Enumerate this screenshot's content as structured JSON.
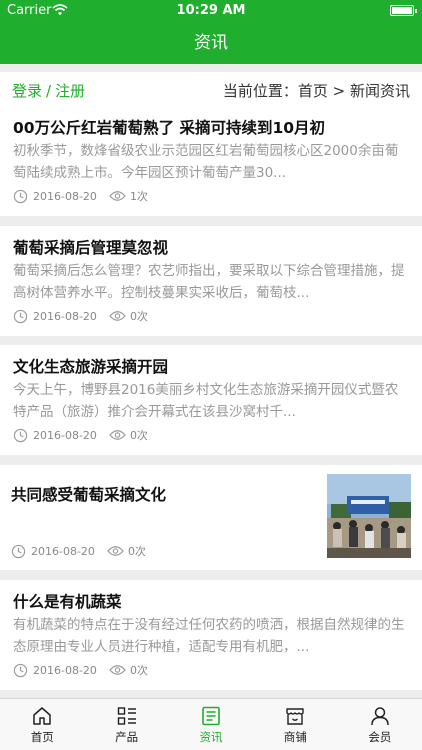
{
  "status": {
    "carrier": "Carrier",
    "time": "10:29 AM"
  },
  "header": {
    "title": "资讯"
  },
  "crumb": {
    "login": "登录",
    "sep": "/",
    "register": "注册",
    "location": "当前位置：首页 > 新闻资讯"
  },
  "articles": [
    {
      "title": "00万公斤红岩葡萄熟了 采摘可持续到10月初",
      "desc": "初秋季节，数烽省级农业示范园区红岩葡萄园核心区2000余亩葡萄陆续成熟上市。今年园区预计葡萄产量30...",
      "date": "2016-08-20",
      "views": "1次"
    },
    {
      "title": "葡萄采摘后管理莫忽视",
      "desc": "葡萄采摘后怎么管理？农艺师指出，要采取以下综合管理措施，提高树体营养水平。控制枝蔓果实采收后，葡萄枝...",
      "date": "2016-08-20",
      "views": "0次"
    },
    {
      "title": "文化生态旅游采摘开园",
      "desc": "今天上午，博野县2016美丽乡村文化生态旅游采摘开园仪式暨农特产品（旅游）推介会开幕式在该县沙窝村千...",
      "date": "2016-08-20",
      "views": "0次"
    },
    {
      "title": "共同感受葡萄采摘文化",
      "desc": "",
      "date": "2016-08-20",
      "views": "0次"
    },
    {
      "title": "什么是有机蔬菜",
      "desc": "有机蔬菜的特点在于没有经过任何农药的喷洒，根据自然规律的生态原理由专业人员进行种植，适配专用有机肥，...",
      "date": "2016-08-20",
      "views": "0次"
    }
  ],
  "tabs": [
    {
      "label": "首页",
      "icon": "home-icon"
    },
    {
      "label": "产品",
      "icon": "grid-list-icon"
    },
    {
      "label": "资讯",
      "icon": "news-icon"
    },
    {
      "label": "商铺",
      "icon": "store-icon"
    },
    {
      "label": "会员",
      "icon": "user-icon"
    }
  ],
  "colors": {
    "accent": "#1fae2d",
    "background": "#ededed"
  }
}
